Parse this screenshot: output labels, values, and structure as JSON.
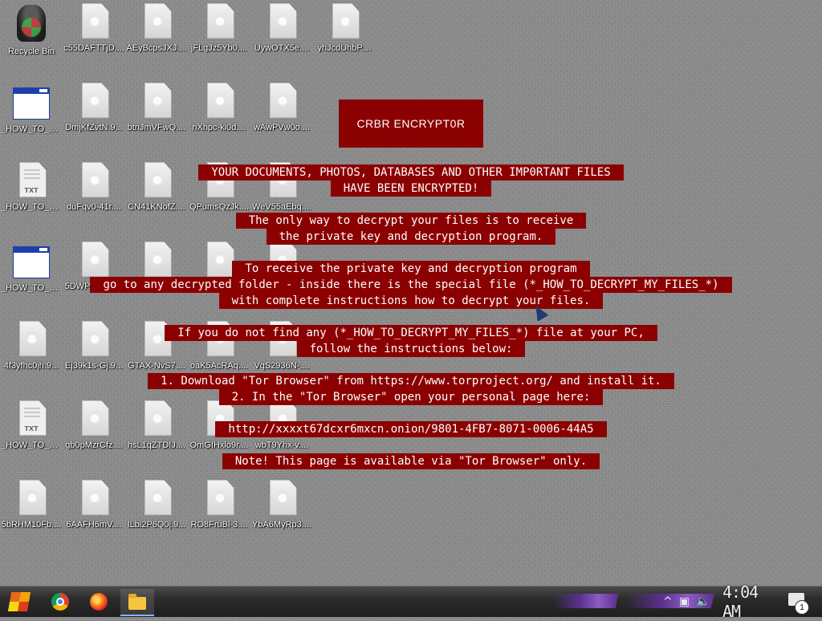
{
  "desktop": {
    "recycle_bin": {
      "label": "Recycle Bin",
      "icon": "recycle-bin-icon"
    },
    "files": [
      {
        "label": "c55DAFTTjD....",
        "type": "file"
      },
      {
        "label": "AEyBcpsJXJ....",
        "type": "file"
      },
      {
        "label": "jFLgJz5Yb0....",
        "type": "file"
      },
      {
        "label": "UywOTX5e....",
        "type": "file"
      },
      {
        "label": "yhJcdUhbP....",
        "type": "file"
      },
      {
        "label": "_HOW_TO_D...",
        "type": "hta"
      },
      {
        "label": "DmjKfZvtN.9...",
        "type": "file"
      },
      {
        "label": "btnJmVFwQ....",
        "type": "file"
      },
      {
        "label": "nXhpc-ki0d....",
        "type": "file"
      },
      {
        "label": "wAwPVw0o....",
        "type": "file"
      },
      {
        "label": "_HOW_TO_D...",
        "type": "txt"
      },
      {
        "label": "duFqv0-41r....",
        "type": "file"
      },
      {
        "label": "CN41KNofZ....",
        "type": "file"
      },
      {
        "label": "QPumsQzJk....",
        "type": "file"
      },
      {
        "label": "WeV55aEbq....",
        "type": "file"
      },
      {
        "label": "_HOW_TO_D...",
        "type": "hta"
      },
      {
        "label": "5DWPKyzlD....",
        "type": "file"
      },
      {
        "label": "Cou0uqpZB....",
        "type": "file"
      },
      {
        "label": "0402VK0dW....",
        "type": "file"
      },
      {
        "label": "XVzyjI5H9F....",
        "type": "file"
      },
      {
        "label": "4f3yfhc0jh.9...",
        "type": "file"
      },
      {
        "label": "Ej39k1s-Gj.9...",
        "type": "file"
      },
      {
        "label": "GTAX-NvS7....",
        "type": "file"
      },
      {
        "label": "oaK5AcRAq....",
        "type": "file"
      },
      {
        "label": "VgS2936N-....",
        "type": "file"
      },
      {
        "label": "_HOW_TO_D...",
        "type": "txt"
      },
      {
        "label": "gb0pMzrCfz....",
        "type": "file"
      },
      {
        "label": "hsL1qZTDIJ....",
        "type": "file"
      },
      {
        "label": "OmGIHxlo9r....",
        "type": "file"
      },
      {
        "label": "wbT9Yhx-v....",
        "type": "file"
      },
      {
        "label": "5bRHM10Fb....",
        "type": "file"
      },
      {
        "label": "6AAFH6mV....",
        "type": "file"
      },
      {
        "label": "ILbi2P6Q0j.9...",
        "type": "file"
      },
      {
        "label": "RO8FruBl-3....",
        "type": "file"
      },
      {
        "label": "YbA6MyRp3....",
        "type": "file"
      }
    ]
  },
  "ransom_note": {
    "title": "CRBR ENCRYPT0R",
    "lines": [
      "YOUR DOCUMENTS, PHOTOS, DATABASES AND OTHER IMP0RTANT FILES",
      "HAVE BEEN ENCRYPTED!",
      "The only way to decrypt your files is to receive",
      "the private key and decryption program.",
      "To receive the private key and decryption program",
      "go to any decrypted folder - inside there is the special file (*_HOW_TO_DECRYPT_MY_FILES_*)",
      "with complete instructions how to decrypt your files.",
      "If you do not find any (*_HOW_TO_DECRYPT_MY_FILES_*) file at your PC,",
      "follow the instructions below:",
      "1. Download \"Tor Browser\" from https://www.torproject.org/ and install it.",
      "2. In the \"Tor Browser\" open your personal page here:",
      "http://xxxxt67dcxr6mxcn.onion/9801-4FB7-8071-0006-44A5",
      "Note! This page is available via \"Tor Browser\" only."
    ]
  },
  "taskbar": {
    "start_icon": "start-logo-icon",
    "apps": [
      {
        "name": "Google Chrome",
        "icon": "chrome-icon"
      },
      {
        "name": "Firefox",
        "icon": "firefox-icon"
      },
      {
        "name": "File Explorer",
        "icon": "folder-icon"
      }
    ],
    "tray": {
      "show_hidden": "^",
      "network_icon": "network-icon",
      "volume_icon": "volume-icon"
    },
    "clock": "4:04 AM",
    "notification_count": "1"
  }
}
